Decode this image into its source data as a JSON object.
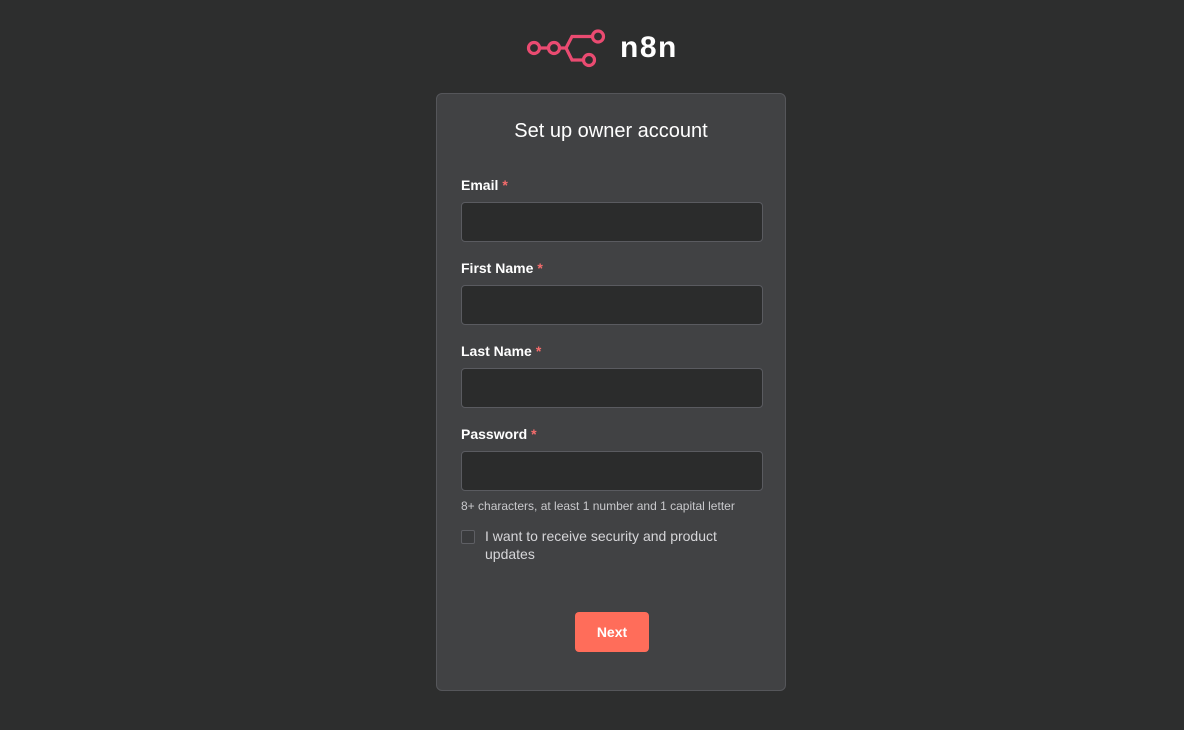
{
  "brand": {
    "name": "n8n",
    "icon": "n8n-logo-icon",
    "accent_color": "#ea4b71"
  },
  "form": {
    "title": "Set up owner account",
    "required_marker": "*",
    "fields": [
      {
        "label": "Email",
        "value": "",
        "placeholder": ""
      },
      {
        "label": "First Name",
        "value": "",
        "placeholder": ""
      },
      {
        "label": "Last Name",
        "value": "",
        "placeholder": ""
      },
      {
        "label": "Password",
        "value": "",
        "placeholder": ""
      }
    ],
    "password_hint": "8+ characters, at least 1 number and 1 capital letter",
    "updates_checkbox": {
      "label": "I want to receive security and product updates",
      "checked": false
    },
    "submit_label": "Next",
    "submit_color": "#ff6d5a"
  }
}
